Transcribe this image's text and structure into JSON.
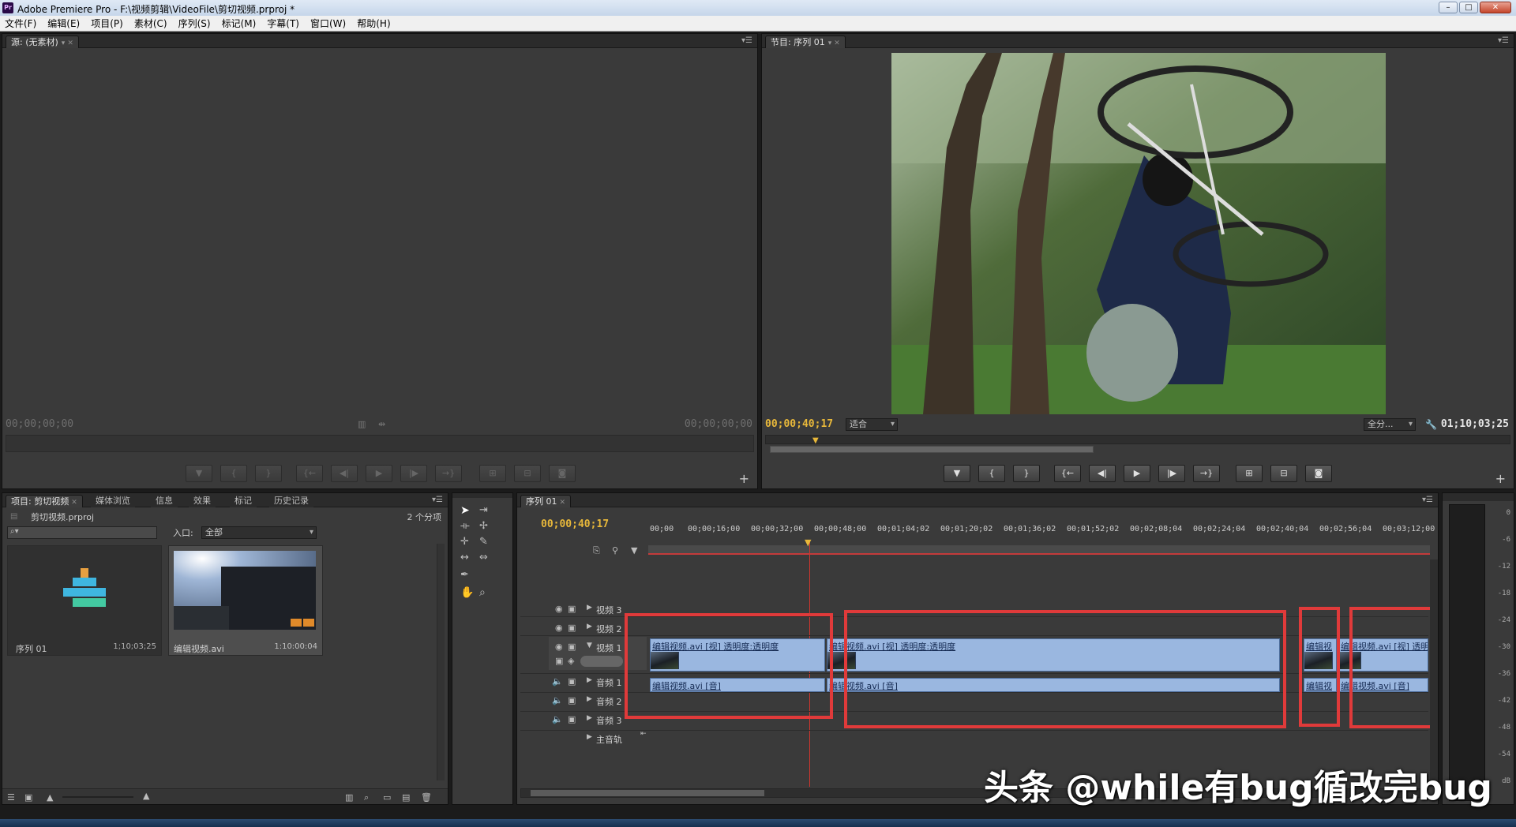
{
  "window": {
    "title": "Adobe Premiere Pro - F:\\视频剪辑\\VideoFile\\剪切视频.prproj *",
    "logo": "Pr"
  },
  "menu": [
    "文件(F)",
    "编辑(E)",
    "项目(P)",
    "素材(C)",
    "序列(S)",
    "标记(M)",
    "字幕(T)",
    "窗口(W)",
    "帮助(H)"
  ],
  "source": {
    "tab": "源: (无素材)",
    "tc_in": "00;00;00;00",
    "tc_out": "00;00;00;00"
  },
  "program": {
    "tab": "节目: 序列 01",
    "tc_current": "00;00;40;17",
    "zoom": "适合",
    "quality": "全分...",
    "tc_duration": "01;10;03;25"
  },
  "project": {
    "tabs": [
      "项目: 剪切视频",
      "媒体浏览",
      "信息",
      "效果",
      "标记",
      "历史记录"
    ],
    "file": "剪切视频.prproj",
    "count": "2 个分项",
    "in_label": "入口:",
    "in_value": "全部",
    "items": [
      {
        "name": "序列 01",
        "duration": "1;10;03;25"
      },
      {
        "name": "编辑视频.avi",
        "duration": "1:10:00:04"
      }
    ]
  },
  "timeline": {
    "tab": "序列 01",
    "tc": "00;00;40;17",
    "ruler": [
      "00;00",
      "00;00;16;00",
      "00;00;32;00",
      "00;00;48;00",
      "00;01;04;02",
      "00;01;20;02",
      "00;01;36;02",
      "00;01;52;02",
      "00;02;08;04",
      "00;02;24;04",
      "00;02;40;04",
      "00;02;56;04",
      "00;03;12;00"
    ],
    "tracks": [
      "视频 3",
      "视频 2",
      "视频 1",
      "音频 1",
      "音频 2",
      "音频 3",
      "主音轨"
    ],
    "video_clips": [
      "编辑视频.avi [视] 透明度:透明度",
      "编辑视频.avi [视] 透明度:透明度",
      "编辑视",
      "编辑视频.avi [视] 透明"
    ],
    "audio_clips": [
      "编辑视频.avi [音]",
      "编辑视频.avi [音]",
      "编辑视",
      "编辑视频.avi [音]"
    ]
  },
  "meter": [
    "0",
    "-6",
    "-12",
    "-18",
    "-24",
    "-30",
    "-36",
    "-42",
    "-48",
    "-54",
    "dB"
  ],
  "watermark": "头条 @while有bug循改完bug"
}
